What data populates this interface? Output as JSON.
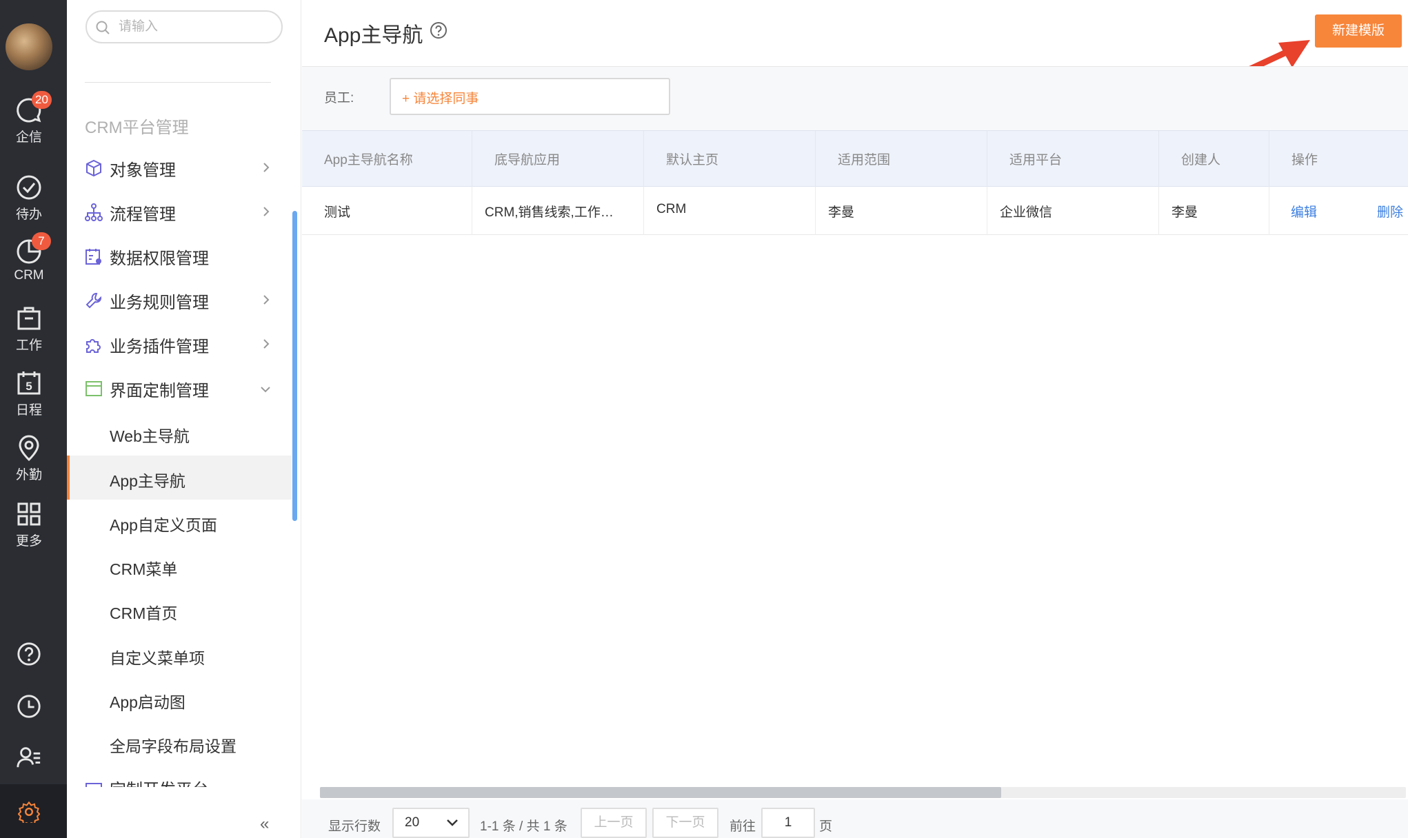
{
  "rail": {
    "items": [
      {
        "label": "企信",
        "icon": "chat-icon",
        "badge": "20"
      },
      {
        "label": "待办",
        "icon": "check-circle-icon",
        "badge": ""
      },
      {
        "label": "CRM",
        "icon": "pie-chart-icon",
        "badge": "7"
      },
      {
        "label": "工作",
        "icon": "briefcase-icon",
        "badge": ""
      },
      {
        "label": "日程",
        "icon": "calendar-icon",
        "badge": "",
        "date": "5"
      },
      {
        "label": "外勤",
        "icon": "location-pin-icon",
        "badge": ""
      },
      {
        "label": "更多",
        "icon": "grid-icon",
        "badge": ""
      }
    ],
    "bottom_icons": [
      "help-icon",
      "clock-icon",
      "contacts-icon",
      "settings-icon"
    ]
  },
  "sidebar": {
    "search_placeholder": "请输入",
    "section_title": "CRM平台管理",
    "menu": [
      {
        "label": "对象管理",
        "icon": "cube-icon"
      },
      {
        "label": "流程管理",
        "icon": "flow-icon"
      },
      {
        "label": "数据权限管理",
        "icon": "data-permission-icon"
      },
      {
        "label": "业务规则管理",
        "icon": "wrench-icon"
      },
      {
        "label": "业务插件管理",
        "icon": "puzzle-icon"
      },
      {
        "label": "界面定制管理",
        "icon": "window-icon"
      }
    ],
    "submenu": [
      {
        "label": "Web主导航"
      },
      {
        "label": "App主导航"
      },
      {
        "label": "App自定义页面"
      },
      {
        "label": "CRM菜单"
      },
      {
        "label": "CRM首页"
      },
      {
        "label": "自定义菜单项"
      },
      {
        "label": "App启动图"
      },
      {
        "label": "全局字段布局设置"
      }
    ],
    "cut_item": "定制开发平台",
    "collapse": "«"
  },
  "main": {
    "title": "App主导航",
    "new_button": "新建模版",
    "filter_label": "员工:",
    "staff_picker": "+ 请选择同事",
    "table": {
      "headers": [
        "App主导航名称",
        "底导航应用",
        "默认主页",
        "适用范围",
        "适用平台",
        "创建人",
        "操作"
      ],
      "rows": [
        {
          "name": "测试",
          "apps": "CRM,销售线索,工作…",
          "home": "CRM",
          "scope": "李曼",
          "platform": "企业微信",
          "creator": "李曼",
          "edit": "编辑",
          "delete": "删除"
        }
      ]
    },
    "pager": {
      "rows_label": "显示行数",
      "rows_value": "20",
      "range": "1-1 条 / 共 1 条",
      "prev": "上一页",
      "next": "下一页",
      "goto": "前往",
      "page_value": "1",
      "page_suffix": "页"
    }
  },
  "colors": {
    "accent": "#f7853a",
    "rail_bg": "#2b2d33",
    "badge": "#f05b3f",
    "link": "#3d7fe0",
    "annotation_arrow": "#e8412c"
  }
}
